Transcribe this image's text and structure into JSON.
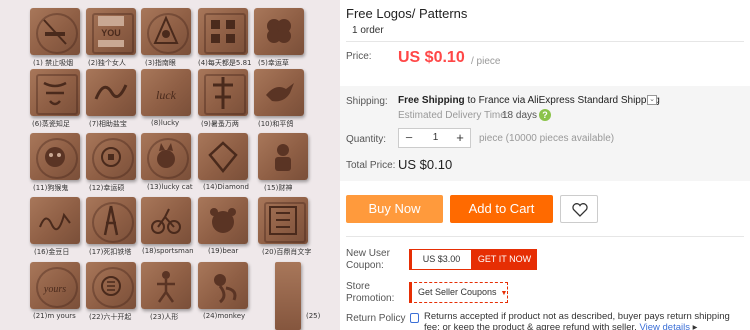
{
  "gallery": {
    "captions": [
      "(1) 禁止吸烟",
      "(2)独个女人",
      "(3)指南眼",
      "(4)每天都是5.81",
      "(5)幸运草",
      "(6)蒸瓷知足",
      "(7)相助盐宝",
      "(8)lucky",
      "(9)暑蚤万两",
      "(10)和平鸽",
      "(11)狗猴鬼",
      "(12)幸运硕",
      "(13)lucky cat",
      "(14)Diamond",
      "(15)财神",
      "(16)金豆日",
      "(17)死扣铁塔",
      "(18)sportsman",
      "(19)bear",
      "(20)百鼎肖文字",
      "(21)m yours",
      "(22)六十开起",
      "(23)人形",
      "(24)monkey",
      "(25)"
    ]
  },
  "product": {
    "title": "Free Logos/ Patterns",
    "order_count": "1 order",
    "price_label": "Price:",
    "price": "US $0.10",
    "per_piece": "/ piece",
    "shipping_label": "Shipping:",
    "shipping_free": "Free Shipping",
    "shipping_to": " to France via AliExpress Standard Shipping",
    "eta_label": "Estimated Delivery Time:",
    "eta_days": "18 days",
    "quantity_label": "Quantity:",
    "quantity_value": "1",
    "quantity_available": "piece (10000 pieces available)",
    "total_label": "Total Price:",
    "total_value": "US $0.10",
    "buy_now": "Buy Now",
    "add_to_cart": "Add to Cart",
    "coupon_label": "New User\nCoupon:",
    "coupon_value": "US $3.00",
    "coupon_action": "GET IT NOW",
    "promo_label": "Store\nPromotion:",
    "promo_value": "Get Seller Coupons",
    "return_label": "Return Policy",
    "return_text": "Returns accepted if product not as described, buyer pays return shipping fee; or keep the product & agree refund with seller.",
    "return_link": "View details",
    "help_icon_text": "?"
  },
  "colors": {
    "accent_red": "#ff4747",
    "buy_now_bg": "#ff9a3c",
    "cart_bg": "#ff6a00",
    "coupon_red": "#e62e04",
    "link_blue": "#3b6fd6"
  },
  "icons": [
    "chevron-down-icon",
    "help-icon",
    "minus-icon",
    "plus-icon",
    "heart-icon",
    "return-policy-icon",
    "caret-right-icon"
  ]
}
